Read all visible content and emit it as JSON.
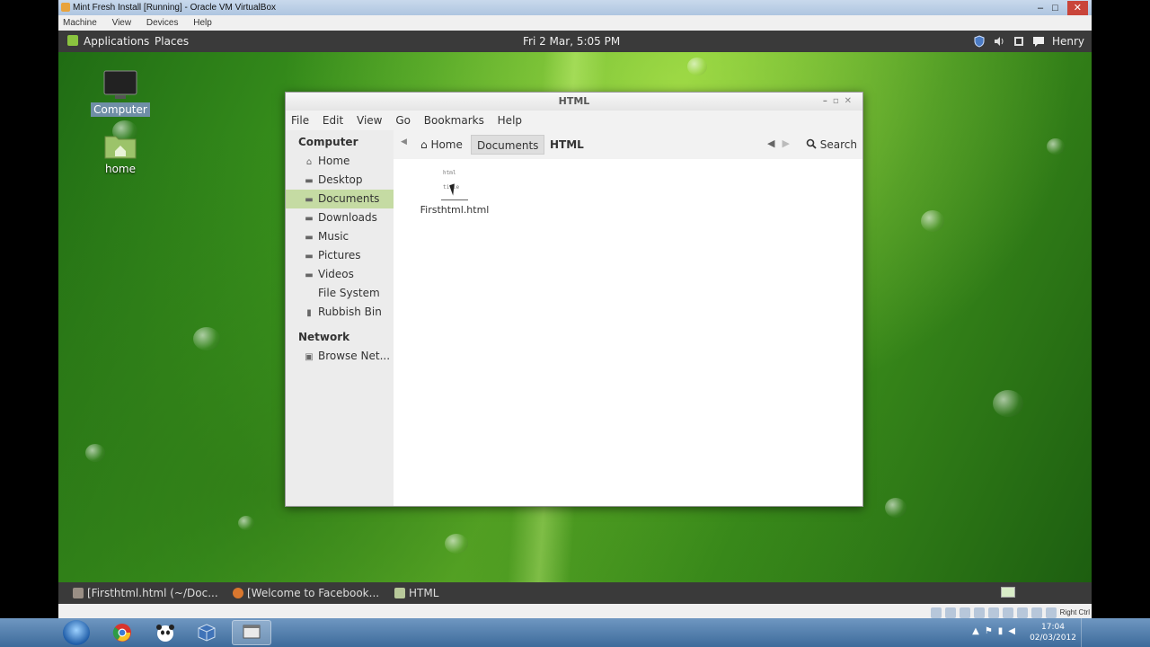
{
  "vbox": {
    "title": "Mint Fresh Install [Running] - Oracle VM VirtualBox",
    "menu": [
      "Machine",
      "View",
      "Devices",
      "Help"
    ],
    "controls": [
      "–",
      "□",
      "✕"
    ],
    "host_key_label": "Right Ctrl"
  },
  "guest_panel": {
    "applications": "Applications",
    "places": "Places",
    "clock": "Fri  2 Mar,  5:05 PM",
    "user": "Henry"
  },
  "desktop_icons": [
    {
      "label": "Computer"
    },
    {
      "label": "home"
    }
  ],
  "file_manager": {
    "title": "HTML",
    "menu": [
      "File",
      "Edit",
      "View",
      "Go",
      "Bookmarks",
      "Help"
    ],
    "sidebar": {
      "computer_header": "Computer",
      "computer_items": [
        {
          "label": "Home",
          "icon": "home-icon"
        },
        {
          "label": "Desktop",
          "icon": "desktop-folder-icon"
        },
        {
          "label": "Documents",
          "icon": "documents-folder-icon"
        },
        {
          "label": "Downloads",
          "icon": "downloads-folder-icon"
        },
        {
          "label": "Music",
          "icon": "music-folder-icon"
        },
        {
          "label": "Pictures",
          "icon": "pictures-folder-icon"
        },
        {
          "label": "Videos",
          "icon": "videos-folder-icon"
        },
        {
          "label": "File System",
          "icon": "drive-icon"
        },
        {
          "label": "Rubbish Bin",
          "icon": "trash-icon"
        }
      ],
      "network_header": "Network",
      "network_items": [
        {
          "label": "Browse Net...",
          "icon": "network-icon"
        }
      ]
    },
    "pathbar": {
      "home": "Home",
      "documents": "Documents",
      "current": "HTML",
      "search": "Search"
    },
    "files": [
      {
        "name": "Firsthtml.html",
        "thumb_lines": [
          "html",
          "title"
        ]
      }
    ]
  },
  "guest_taskbar": [
    {
      "label": "[Firsthtml.html (~/Doc...",
      "icon_color": "#9a8f85"
    },
    {
      "label": "[Welcome to Facebook...",
      "icon_color": "#d9772e"
    },
    {
      "label": "HTML",
      "icon_color": "#b8c99a"
    }
  ],
  "windows_clock": {
    "time": "17:04",
    "date": "02/03/2012"
  }
}
